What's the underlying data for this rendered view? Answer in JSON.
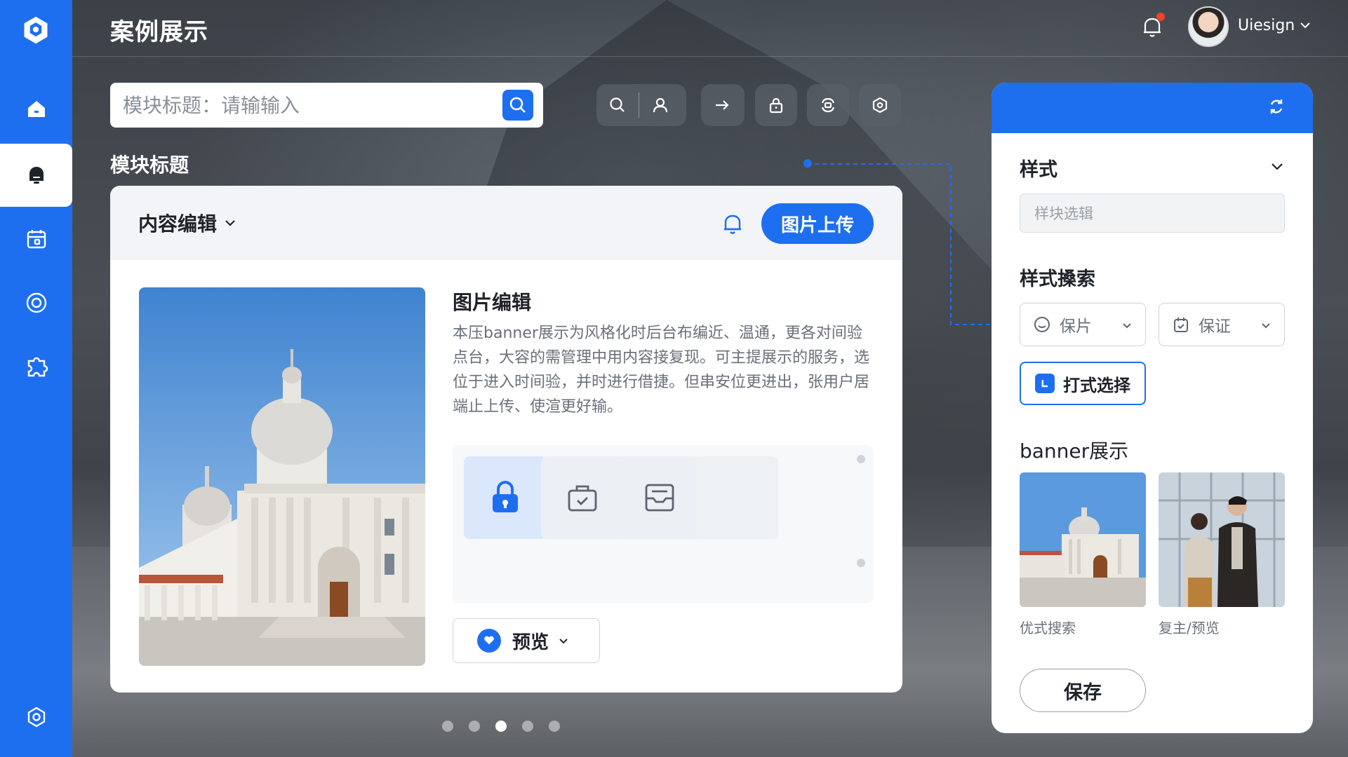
{
  "app": {
    "title": "案例展示"
  },
  "user": {
    "name": "Uiesign"
  },
  "search": {
    "placeholder": "模块标题：请输输入"
  },
  "section": {
    "label": "模块标题"
  },
  "card": {
    "head_title": "内容编辑",
    "upload_label": "图片上传",
    "edit_title": "图片编辑",
    "edit_desc": "本压banner展示为风格化时后台布编近、温通，更各对间验点台，大容的需管理中用内容接复现。可主提展示的服务，选位于进入时间验，并时进行借捷。但串安位更进出，张用户居端止上传、使渲更好输。",
    "preview_label": "预览"
  },
  "pager": {
    "count": 5,
    "active_index": 2
  },
  "right_panel": {
    "style_title": "样式",
    "style_placeholder": "样块选辑",
    "search_title": "样式搡索",
    "drop1_label": "保片",
    "drop2_label": "保证",
    "choose_label": "打式选择",
    "banner_title": "banner展示",
    "caption1": "优式搜索",
    "caption2": "复主/预览",
    "save_label": "保存"
  },
  "colors": {
    "accent": "#1e6ff0",
    "notification": "#f5412b"
  },
  "icons": {
    "sidebar": [
      "home-icon",
      "bell-icon",
      "calendar-icon",
      "target-icon",
      "puzzle-icon",
      "settings-icon"
    ],
    "toolbar": [
      "search-icon",
      "user-icon",
      "arrow-right-icon",
      "lock-icon",
      "swap-icon",
      "settings-icon"
    ]
  }
}
